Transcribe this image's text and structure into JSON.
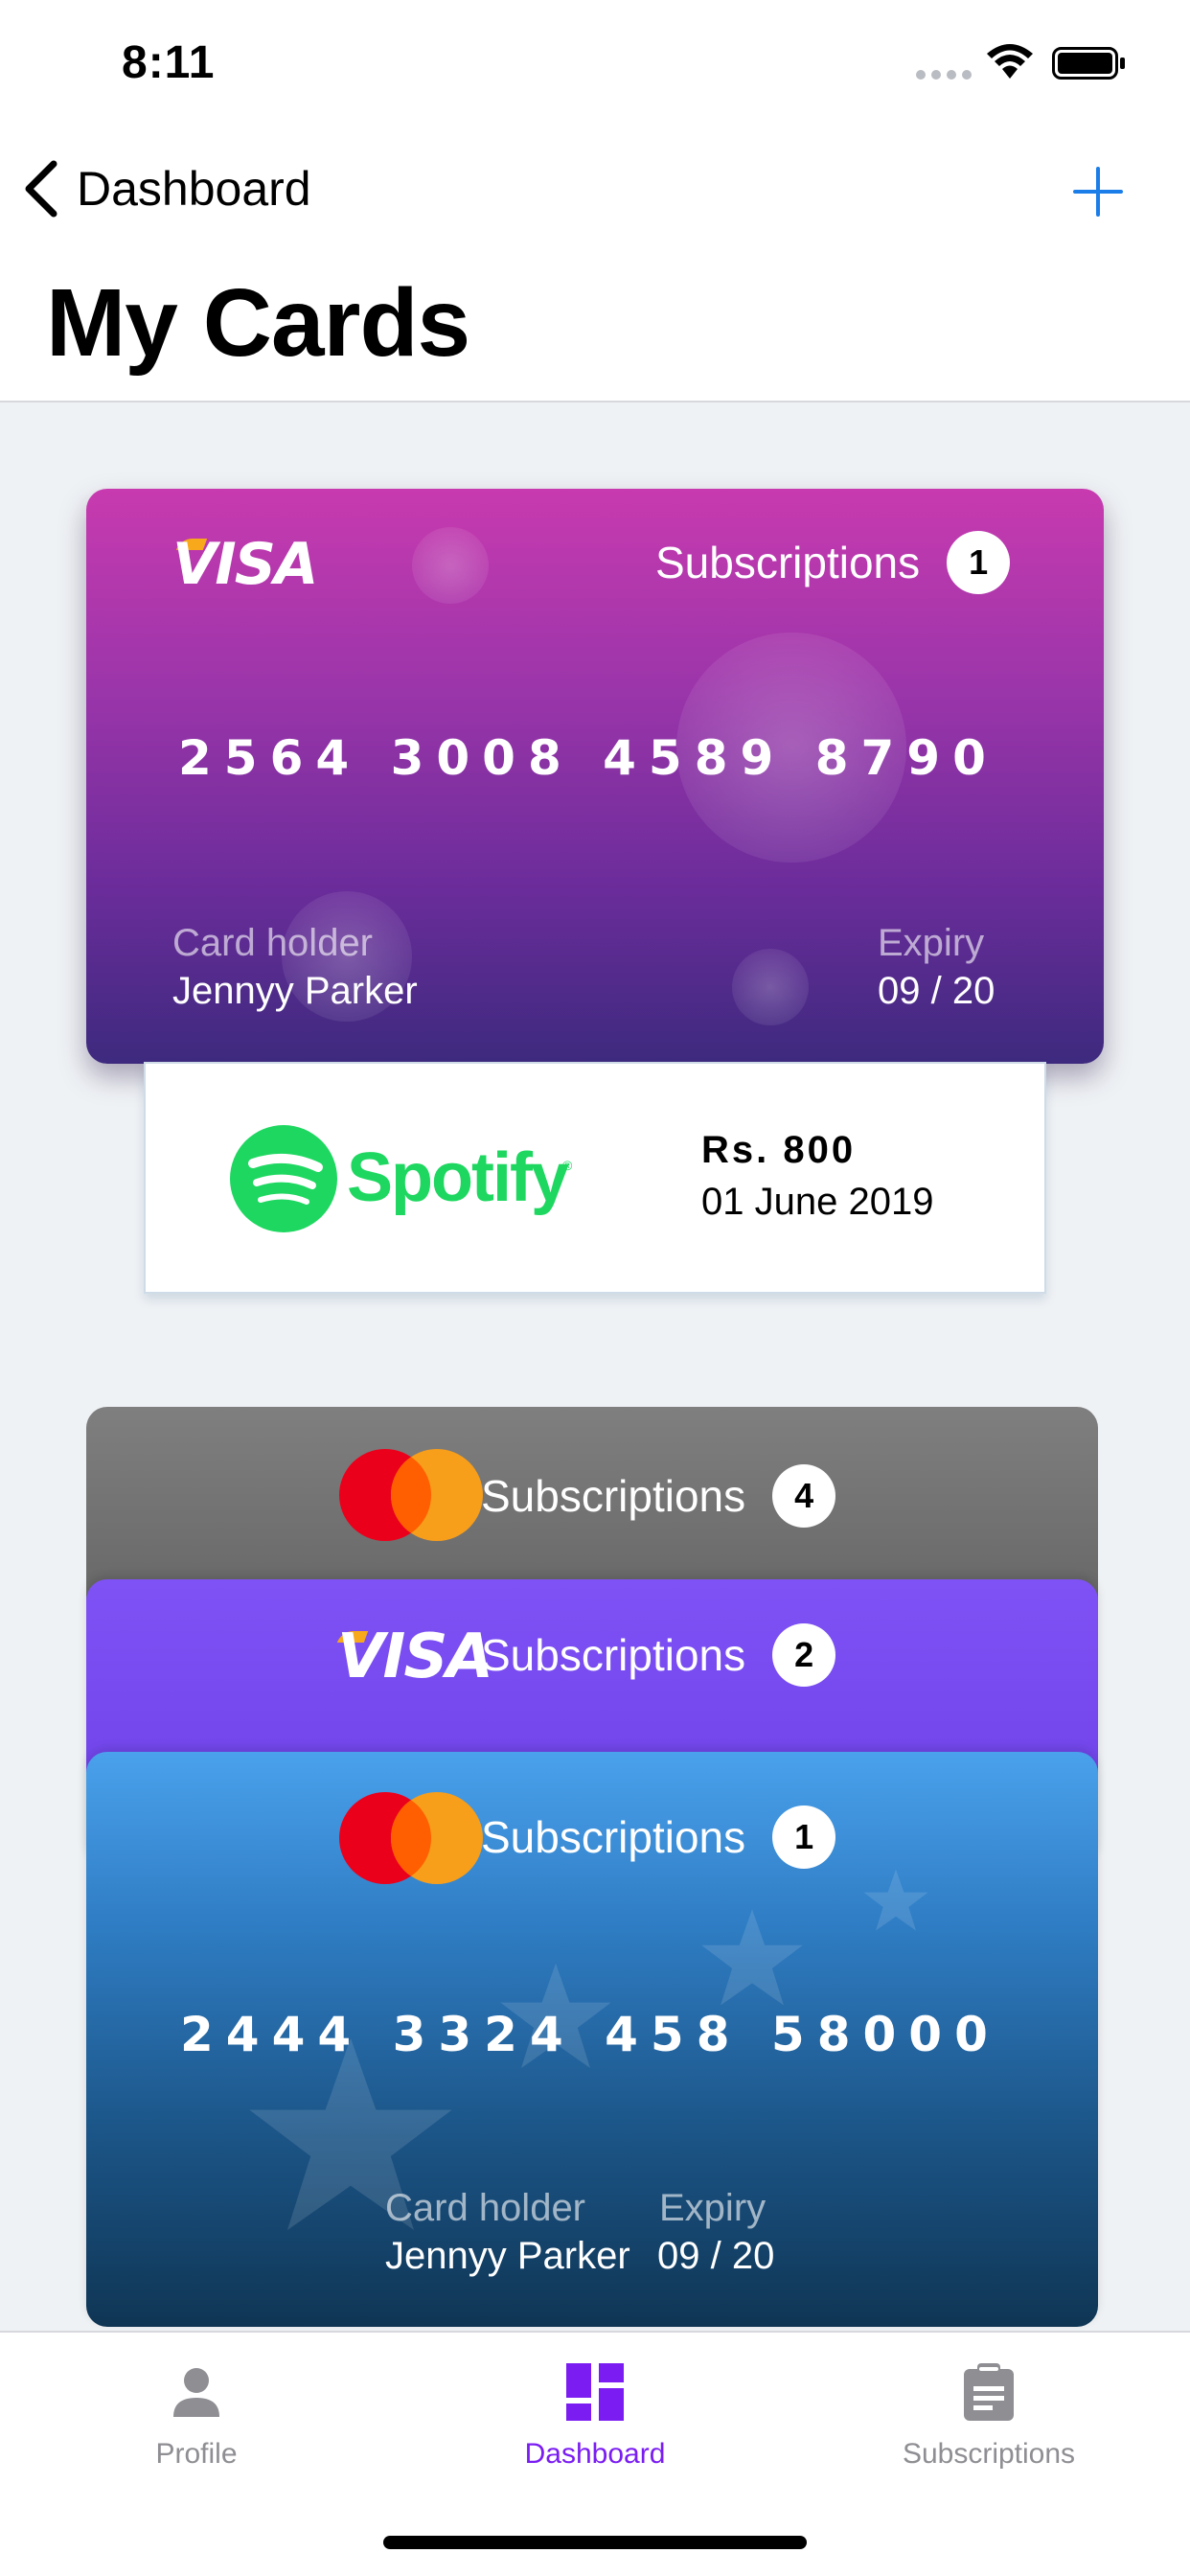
{
  "status_bar": {
    "time": "8:11"
  },
  "nav": {
    "back_label": "Dashboard",
    "title": "My Cards",
    "add_icon": "plus-icon"
  },
  "colors": {
    "accent_blue": "#1a7de8",
    "tab_active": "#7a1cf2",
    "tab_inactive": "#8e8e93",
    "spotify_green": "#1ed760"
  },
  "main_card": {
    "brand": "VISA",
    "subscriptions_label": "Subscriptions",
    "subscriptions_count": "1",
    "number": "2564 3008 4589 8790",
    "holder_label": "Card holder",
    "holder_name": "Jennyy Parker",
    "expiry_label": "Expiry",
    "expiry": "09 / 20"
  },
  "transaction": {
    "merchant": "Spotify",
    "amount": "Rs. 800",
    "date": "01 June 2019"
  },
  "stack": [
    {
      "brand": "mastercard",
      "subscriptions_label": "Subscriptions",
      "subscriptions_count": "4"
    },
    {
      "brand": "VISA",
      "subscriptions_label": "Subscriptions",
      "subscriptions_count": "2"
    },
    {
      "brand": "mastercard",
      "subscriptions_label": "Subscriptions",
      "subscriptions_count": "1",
      "number": "2444 3324 458 58000",
      "holder_label": "Card holder",
      "holder_name": "Jennyy Parker",
      "expiry_label": "Expiry",
      "expiry": "09 / 20"
    }
  ],
  "tabs": [
    {
      "label": "Profile",
      "icon": "person-icon",
      "active": false
    },
    {
      "label": "Dashboard",
      "icon": "dashboard-grid-icon",
      "active": true
    },
    {
      "label": "Subscriptions",
      "icon": "clipboard-icon",
      "active": false
    }
  ]
}
